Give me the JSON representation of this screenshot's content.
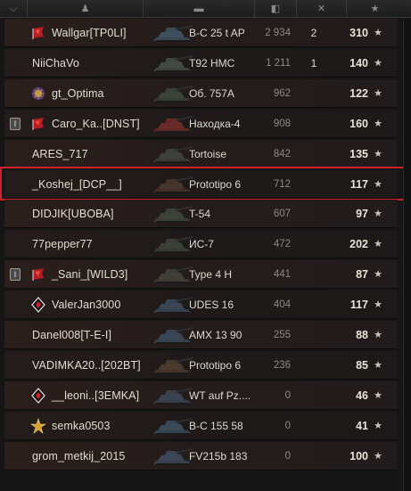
{
  "header": {
    "columns": [
      {
        "icon": "squad-icon",
        "glyph": "⌵"
      },
      {
        "icon": "player-icon",
        "glyph": "♟"
      },
      {
        "icon": "vehicle-icon",
        "glyph": "▬"
      },
      {
        "icon": "damage-icon",
        "glyph": "◧"
      },
      {
        "icon": "frags-icon",
        "glyph": "✕"
      },
      {
        "icon": "xp-star-icon",
        "glyph": "★"
      }
    ]
  },
  "rows": [
    {
      "rank": "",
      "badge": "red-flag",
      "player": "Wallgar[TP0LI]",
      "vehicle": "B-C 25 t AP",
      "damage": "2 934",
      "kills": "2",
      "xp": "310",
      "highlight": false
    },
    {
      "rank": "",
      "badge": "",
      "player": "NiiChaVo",
      "vehicle": "T92 HMC",
      "damage": "1 211",
      "kills": "1",
      "xp": "140",
      "highlight": false
    },
    {
      "rank": "",
      "badge": "purple-flower",
      "player": "gt_Optima",
      "vehicle": "Об. 757А",
      "damage": "962",
      "kills": "",
      "xp": "122",
      "highlight": false
    },
    {
      "rank": "I",
      "badge": "red-flag",
      "player": "Caro_Ka..[DNST]",
      "vehicle": "Находка-4",
      "damage": "908",
      "kills": "",
      "xp": "160",
      "highlight": false
    },
    {
      "rank": "",
      "badge": "",
      "player": "ARES_717",
      "vehicle": "Tortoise",
      "damage": "842",
      "kills": "",
      "xp": "135",
      "highlight": false
    },
    {
      "rank": "",
      "badge": "",
      "player": "_Koshej_[DCP__]",
      "vehicle": "Prototipo 6",
      "damage": "712",
      "kills": "",
      "xp": "117",
      "highlight": true
    },
    {
      "rank": "",
      "badge": "",
      "player": "DIDJIK[UBOBA]",
      "vehicle": "T-54",
      "damage": "607",
      "kills": "",
      "xp": "97",
      "highlight": false
    },
    {
      "rank": "",
      "badge": "",
      "player": "77pepper77",
      "vehicle": "ИС-7",
      "damage": "472",
      "kills": "",
      "xp": "202",
      "highlight": false
    },
    {
      "rank": "I",
      "badge": "red-flag",
      "player": "_Sani_[WILD3]",
      "vehicle": "Type 4 H",
      "damage": "441",
      "kills": "",
      "xp": "87",
      "highlight": false
    },
    {
      "rank": "",
      "badge": "diamond",
      "player": "ValerJan3000",
      "vehicle": "UDES 16",
      "damage": "404",
      "kills": "",
      "xp": "117",
      "highlight": false
    },
    {
      "rank": "",
      "badge": "",
      "player": "Danel008[T-E-I]",
      "vehicle": "AMX 13 90",
      "damage": "255",
      "kills": "",
      "xp": "88",
      "highlight": false
    },
    {
      "rank": "",
      "badge": "",
      "player": "VADIMKA20..[202BT]",
      "vehicle": "Prototipo 6",
      "damage": "236",
      "kills": "",
      "xp": "85",
      "highlight": false
    },
    {
      "rank": "",
      "badge": "diamond",
      "player": "__leoni..[3EMKA]",
      "vehicle": "WT auf Pz....",
      "damage": "0",
      "kills": "",
      "xp": "46",
      "highlight": false
    },
    {
      "rank": "",
      "badge": "gold-star",
      "player": "semka0503",
      "vehicle": "B-C 155 58",
      "damage": "0",
      "kills": "",
      "xp": "41",
      "highlight": false
    },
    {
      "rank": "",
      "badge": "",
      "player": "grom_metkij_2015",
      "vehicle": "FV215b 183",
      "damage": "0",
      "kills": "",
      "xp": "100",
      "highlight": false
    }
  ],
  "colors": {
    "highlight": "#d0202a",
    "row_bg": "#241c1a",
    "text": "#e0dcd0",
    "damage_text": "#8d8a84"
  }
}
